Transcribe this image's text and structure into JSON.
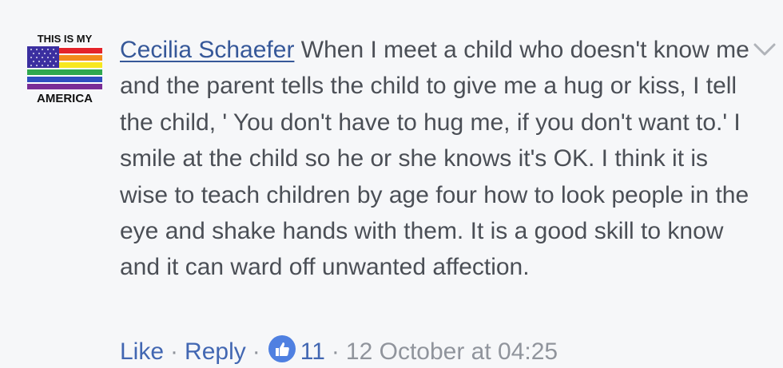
{
  "avatar": {
    "top_text": "THIS IS MY",
    "bottom_text": "AMERICA"
  },
  "comment": {
    "author": "Cecilia Schaefer",
    "text": "When I meet a child who doesn't know me and the parent tells the child to give me a hug or kiss, I tell the child, ' You don't have to hug me, if you don't want to.' I smile at the child so he or she knows it's OK. I think it is wise to teach children by age four how to look people in the eye and shake hands with them. It is a good skill to know and it can ward off unwanted affection."
  },
  "actions": {
    "like_label": "Like",
    "reply_label": "Reply",
    "separator": "·",
    "reaction_count": "11",
    "timestamp": "12 October at 04:25"
  },
  "icons": {
    "like_badge": "thumbs-up-icon",
    "menu": "chevron-down-icon"
  },
  "colors": {
    "author_link": "#365899",
    "action_link": "#4267b2",
    "body_text": "#4b4f56",
    "meta_text": "#90949c",
    "like_badge_bg": "#4f80e1"
  }
}
